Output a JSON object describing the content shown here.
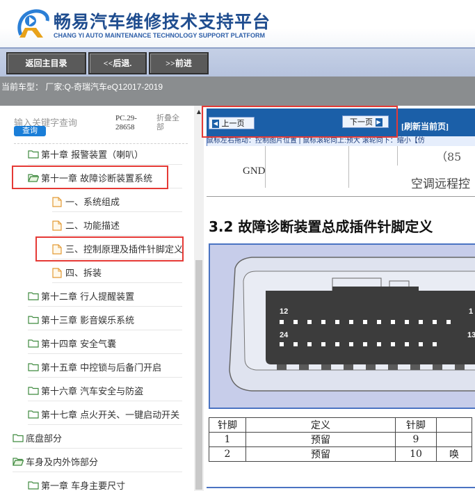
{
  "header": {
    "title": "畅易汽车维修技术支持平台",
    "subtitle": "CHANG YI AUTO MAINTENANCE TECHNOLOGY SUPPORT PLATFORM",
    "logo_color": "#1f4d8f"
  },
  "nav": {
    "home_label": "返回主目录",
    "back_label": "<<后退.",
    "forward_label": ">>前进"
  },
  "model": {
    "text": "当前车型： 厂家:Q-奇瑞汽车eQ12017-2019"
  },
  "search": {
    "placeholder": "输入关键字查询",
    "button_label": "查询",
    "pc_code": "PC.29-28658",
    "collapse_label": "折叠全部"
  },
  "tree": {
    "items": [
      {
        "label": "第十章 报警装置（喇叭）",
        "icon": "folder-icon"
      },
      {
        "label": "第十一章 故障诊断装置系统",
        "icon": "folder-open-icon"
      },
      {
        "label": "一、系统组成",
        "icon": "page-icon"
      },
      {
        "label": "二、功能描述",
        "icon": "page-icon"
      },
      {
        "label": "三、控制原理及插件针脚定义",
        "icon": "page-icon"
      },
      {
        "label": "四、拆装",
        "icon": "page-icon"
      },
      {
        "label": "第十二章 行人提醒装置",
        "icon": "folder-icon"
      },
      {
        "label": "第十三章 影音娱乐系统",
        "icon": "folder-icon"
      },
      {
        "label": "第十四章 安全气囊",
        "icon": "folder-icon"
      },
      {
        "label": "第十五章 中控锁与后备门开启",
        "icon": "folder-icon"
      },
      {
        "label": "第十六章 汽车安全与防盗",
        "icon": "folder-icon"
      },
      {
        "label": "第十七章 点火开关、一键启动开关",
        "icon": "folder-icon"
      },
      {
        "label": "底盘部分",
        "icon": "folder-icon"
      },
      {
        "label": "车身及内外饰部分",
        "icon": "folder-open-icon"
      },
      {
        "label": "第一章 车身主要尺寸",
        "icon": "folder-icon"
      }
    ]
  },
  "content": {
    "prev_label": "上一页",
    "next_label": "下一页",
    "refresh_label": "[刷新当前页]",
    "hint": "鼠标左右拖动：控制图片位置 | 鼠标滚轮向上:预大  滚轮向下：缩小【仿",
    "gnd": "GND",
    "ac_label": "空调远程控",
    "ac_paren": "（85",
    "section_title": "3.2  故障诊断装置总成插件针脚定义",
    "pin_12": "12",
    "pin_24": "24",
    "pin_1": "1",
    "pin_13": "13"
  },
  "pin_table": {
    "headers": [
      "针脚",
      "定义",
      "针脚",
      ""
    ],
    "rows": [
      [
        "1",
        "预留",
        "9",
        ""
      ],
      [
        "2",
        "预留",
        "10",
        "唤"
      ]
    ]
  }
}
